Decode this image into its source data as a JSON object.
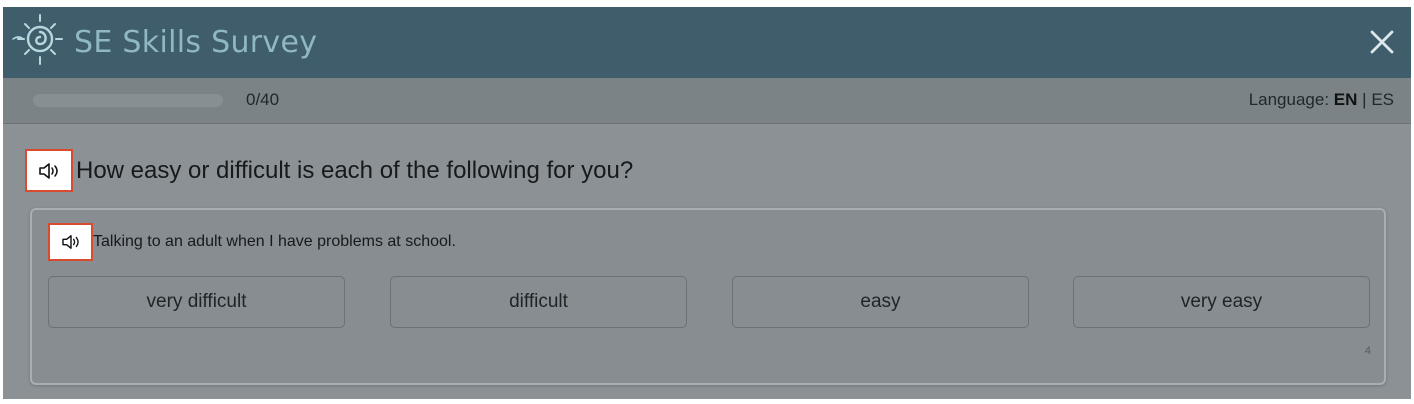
{
  "app": {
    "title": "SE Skills Survey",
    "logo_icon": "sun-swirl-logo-icon",
    "close_icon": "close-icon"
  },
  "progress": {
    "text": "0/40",
    "fraction": 0
  },
  "language": {
    "label": "Language:",
    "options": [
      "EN",
      "ES"
    ],
    "current": "EN",
    "separator": "|"
  },
  "question": {
    "audio_icon": "speaker-icon",
    "title": "How easy or difficult is each of the following for you?"
  },
  "item": {
    "audio_icon": "speaker-icon",
    "text": "Talking to an adult when I have problems at school.",
    "answers": [
      "very difficult",
      "difficult",
      "easy",
      "very easy"
    ],
    "number": "4"
  },
  "colors": {
    "header": "#3f5d6b",
    "title": "#8fb8c2",
    "audio_border": "#d94b2f",
    "overlay": "#8b9194"
  }
}
